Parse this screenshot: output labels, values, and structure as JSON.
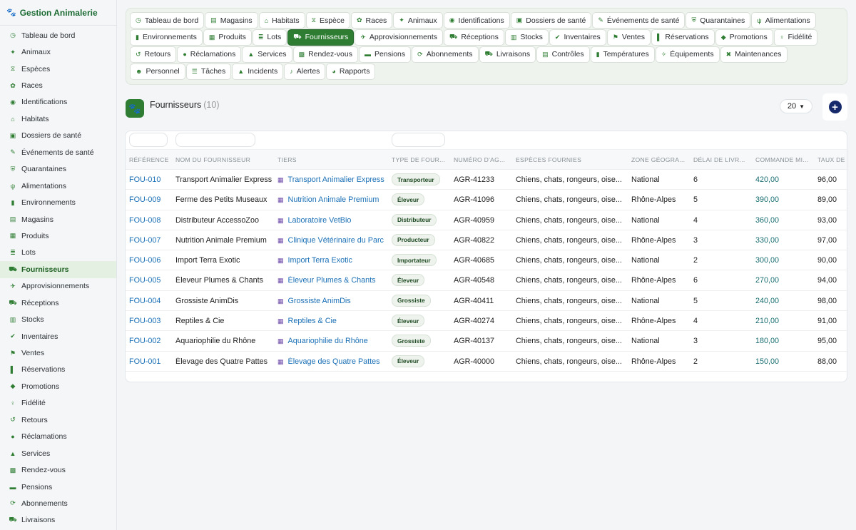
{
  "app": {
    "title": "Gestion Animalerie"
  },
  "sidebar": {
    "items": [
      {
        "label": "Tableau de bord",
        "icon": "◷"
      },
      {
        "label": "Animaux",
        "icon": "✦"
      },
      {
        "label": "Espèces",
        "icon": "⧖"
      },
      {
        "label": "Races",
        "icon": "✿"
      },
      {
        "label": "Identifications",
        "icon": "◉"
      },
      {
        "label": "Habitats",
        "icon": "⌂"
      },
      {
        "label": "Dossiers de santé",
        "icon": "▣"
      },
      {
        "label": "Événements de santé",
        "icon": "✎"
      },
      {
        "label": "Quarantaines",
        "icon": "⛨"
      },
      {
        "label": "Alimentations",
        "icon": "ψ"
      },
      {
        "label": "Environnements",
        "icon": "▮"
      },
      {
        "label": "Magasins",
        "icon": "▤"
      },
      {
        "label": "Produits",
        "icon": "▦"
      },
      {
        "label": "Lots",
        "icon": "≣"
      },
      {
        "label": "Fournisseurs",
        "icon": "⛟",
        "active": true
      },
      {
        "label": "Approvisionnements",
        "icon": "✈"
      },
      {
        "label": "Réceptions",
        "icon": "⛟"
      },
      {
        "label": "Stocks",
        "icon": "▥"
      },
      {
        "label": "Inventaires",
        "icon": "✔"
      },
      {
        "label": "Ventes",
        "icon": "⚑"
      },
      {
        "label": "Réservations",
        "icon": "▌"
      },
      {
        "label": "Promotions",
        "icon": "◆"
      },
      {
        "label": "Fidélité",
        "icon": "♀"
      },
      {
        "label": "Retours",
        "icon": "↺"
      },
      {
        "label": "Réclamations",
        "icon": "●"
      },
      {
        "label": "Services",
        "icon": "▲"
      },
      {
        "label": "Rendez-vous",
        "icon": "▩"
      },
      {
        "label": "Pensions",
        "icon": "▬"
      },
      {
        "label": "Abonnements",
        "icon": "⟳"
      },
      {
        "label": "Livraisons",
        "icon": "⛟"
      }
    ]
  },
  "tabs": [
    [
      {
        "label": "Tableau de bord",
        "icon": "◷"
      },
      {
        "label": "Magasins",
        "icon": "▤"
      },
      {
        "label": "Habitats",
        "icon": "⌂"
      },
      {
        "label": "Espèce",
        "icon": "⧖"
      },
      {
        "label": "Races",
        "icon": "✿"
      },
      {
        "label": "Animaux",
        "icon": "✦"
      },
      {
        "label": "Identifications",
        "icon": "◉"
      },
      {
        "label": "Dossiers de santé",
        "icon": "▣"
      },
      {
        "label": "Événements de santé",
        "icon": "✎"
      },
      {
        "label": "Quarantaines",
        "icon": "⛨"
      },
      {
        "label": "Alimentations",
        "icon": "ψ"
      }
    ],
    [
      {
        "label": "Environnements",
        "icon": "▮"
      },
      {
        "label": "Produits",
        "icon": "▦"
      },
      {
        "label": "Lots",
        "icon": "≣"
      },
      {
        "label": "Fournisseurs",
        "icon": "⛟",
        "active": true
      },
      {
        "label": "Approvisionnements",
        "icon": "✈"
      },
      {
        "label": "Réceptions",
        "icon": "⛟"
      },
      {
        "label": "Stocks",
        "icon": "▥"
      },
      {
        "label": "Inventaires",
        "icon": "✔"
      },
      {
        "label": "Ventes",
        "icon": "⚑"
      },
      {
        "label": "Réservations",
        "icon": "▌"
      },
      {
        "label": "Promotions",
        "icon": "◆"
      },
      {
        "label": "Fidélité",
        "icon": "♀"
      }
    ],
    [
      {
        "label": "Retours",
        "icon": "↺"
      },
      {
        "label": "Réclamations",
        "icon": "●"
      },
      {
        "label": "Services",
        "icon": "▲"
      },
      {
        "label": "Rendez-vous",
        "icon": "▩"
      },
      {
        "label": "Pensions",
        "icon": "▬"
      },
      {
        "label": "Abonnements",
        "icon": "⟳"
      },
      {
        "label": "Livraisons",
        "icon": "⛟"
      },
      {
        "label": "Contrôles",
        "icon": "▤"
      },
      {
        "label": "Températures",
        "icon": "▮"
      },
      {
        "label": "Équipements",
        "icon": "✧"
      },
      {
        "label": "Maintenances",
        "icon": "✖"
      }
    ],
    [
      {
        "label": "Personnel",
        "icon": "☻"
      },
      {
        "label": "Tâches",
        "icon": "☰"
      },
      {
        "label": "Incidents",
        "icon": "▲"
      },
      {
        "label": "Alertes",
        "icon": "♪"
      },
      {
        "label": "Rapports",
        "icon": "◕"
      }
    ]
  ],
  "page": {
    "title": "Fournisseurs",
    "count": "(10)",
    "per_page": "20",
    "add_label": "+"
  },
  "table": {
    "columns": [
      "RÉFÉRENCE",
      "NOM DU FOURNISSEUR",
      "TIERS",
      "TYPE DE FOUR...",
      "NUMÉRO D'AG...",
      "ESPÈCES FOURNIES",
      "ZONE GÉOGRA...",
      "DÉLAI DE LIVR...",
      "COMMANDE MI...",
      "TAUX DE S..."
    ],
    "rows": [
      {
        "ref": "FOU-010",
        "name": "Transport Animalier Express",
        "tiers": "Transport Animalier Express",
        "type": "Transporteur",
        "agr": "AGR-41233",
        "especes": "Chiens, chats, rongeurs, oise...",
        "zone": "National",
        "delai": "6",
        "commande": "420,00",
        "taux": "96,00"
      },
      {
        "ref": "FOU-009",
        "name": "Ferme des Petits Museaux",
        "tiers": "Nutrition Animale Premium",
        "type": "Éleveur",
        "agr": "AGR-41096",
        "especes": "Chiens, chats, rongeurs, oise...",
        "zone": "Rhône-Alpes",
        "delai": "5",
        "commande": "390,00",
        "taux": "89,00"
      },
      {
        "ref": "FOU-008",
        "name": "Distributeur AccessoZoo",
        "tiers": "Laboratoire VetBio",
        "type": "Distributeur",
        "agr": "AGR-40959",
        "especes": "Chiens, chats, rongeurs, oise...",
        "zone": "National",
        "delai": "4",
        "commande": "360,00",
        "taux": "93,00"
      },
      {
        "ref": "FOU-007",
        "name": "Nutrition Animale Premium",
        "tiers": "Clinique Vétérinaire du Parc",
        "type": "Producteur",
        "agr": "AGR-40822",
        "especes": "Chiens, chats, rongeurs, oise...",
        "zone": "Rhône-Alpes",
        "delai": "3",
        "commande": "330,00",
        "taux": "97,00"
      },
      {
        "ref": "FOU-006",
        "name": "Import Terra Exotic",
        "tiers": "Import Terra Exotic",
        "type": "Importateur",
        "agr": "AGR-40685",
        "especes": "Chiens, chats, rongeurs, oise...",
        "zone": "National",
        "delai": "2",
        "commande": "300,00",
        "taux": "90,00"
      },
      {
        "ref": "FOU-005",
        "name": "Éleveur Plumes & Chants",
        "tiers": "Éleveur Plumes & Chants",
        "type": "Éleveur",
        "agr": "AGR-40548",
        "especes": "Chiens, chats, rongeurs, oise...",
        "zone": "Rhône-Alpes",
        "delai": "6",
        "commande": "270,00",
        "taux": "94,00"
      },
      {
        "ref": "FOU-004",
        "name": "Grossiste AnimDis",
        "tiers": "Grossiste AnimDis",
        "type": "Grossiste",
        "agr": "AGR-40411",
        "especes": "Chiens, chats, rongeurs, oise...",
        "zone": "National",
        "delai": "5",
        "commande": "240,00",
        "taux": "98,00"
      },
      {
        "ref": "FOU-003",
        "name": "Reptiles & Cie",
        "tiers": "Reptiles & Cie",
        "type": "Éleveur",
        "agr": "AGR-40274",
        "especes": "Chiens, chats, rongeurs, oise...",
        "zone": "Rhône-Alpes",
        "delai": "4",
        "commande": "210,00",
        "taux": "91,00"
      },
      {
        "ref": "FOU-002",
        "name": "Aquariophilie du Rhône",
        "tiers": "Aquariophilie du Rhône",
        "type": "Grossiste",
        "agr": "AGR-40137",
        "especes": "Chiens, chats, rongeurs, oise...",
        "zone": "National",
        "delai": "3",
        "commande": "180,00",
        "taux": "95,00"
      },
      {
        "ref": "FOU-001",
        "name": "Élevage des Quatre Pattes",
        "tiers": "Élevage des Quatre Pattes",
        "type": "Éleveur",
        "agr": "AGR-40000",
        "especes": "Chiens, chats, rongeurs, oise...",
        "zone": "Rhône-Alpes",
        "delai": "2",
        "commande": "150,00",
        "taux": "88,00"
      }
    ]
  },
  "icons": {
    "brand": "paw-icon",
    "tiers": "building-icon",
    "logo": "paw-icon"
  },
  "colors": {
    "accent": "#2e7d32",
    "link": "#1a6fb5",
    "money": "#1a6e72",
    "add": "#15296b"
  }
}
